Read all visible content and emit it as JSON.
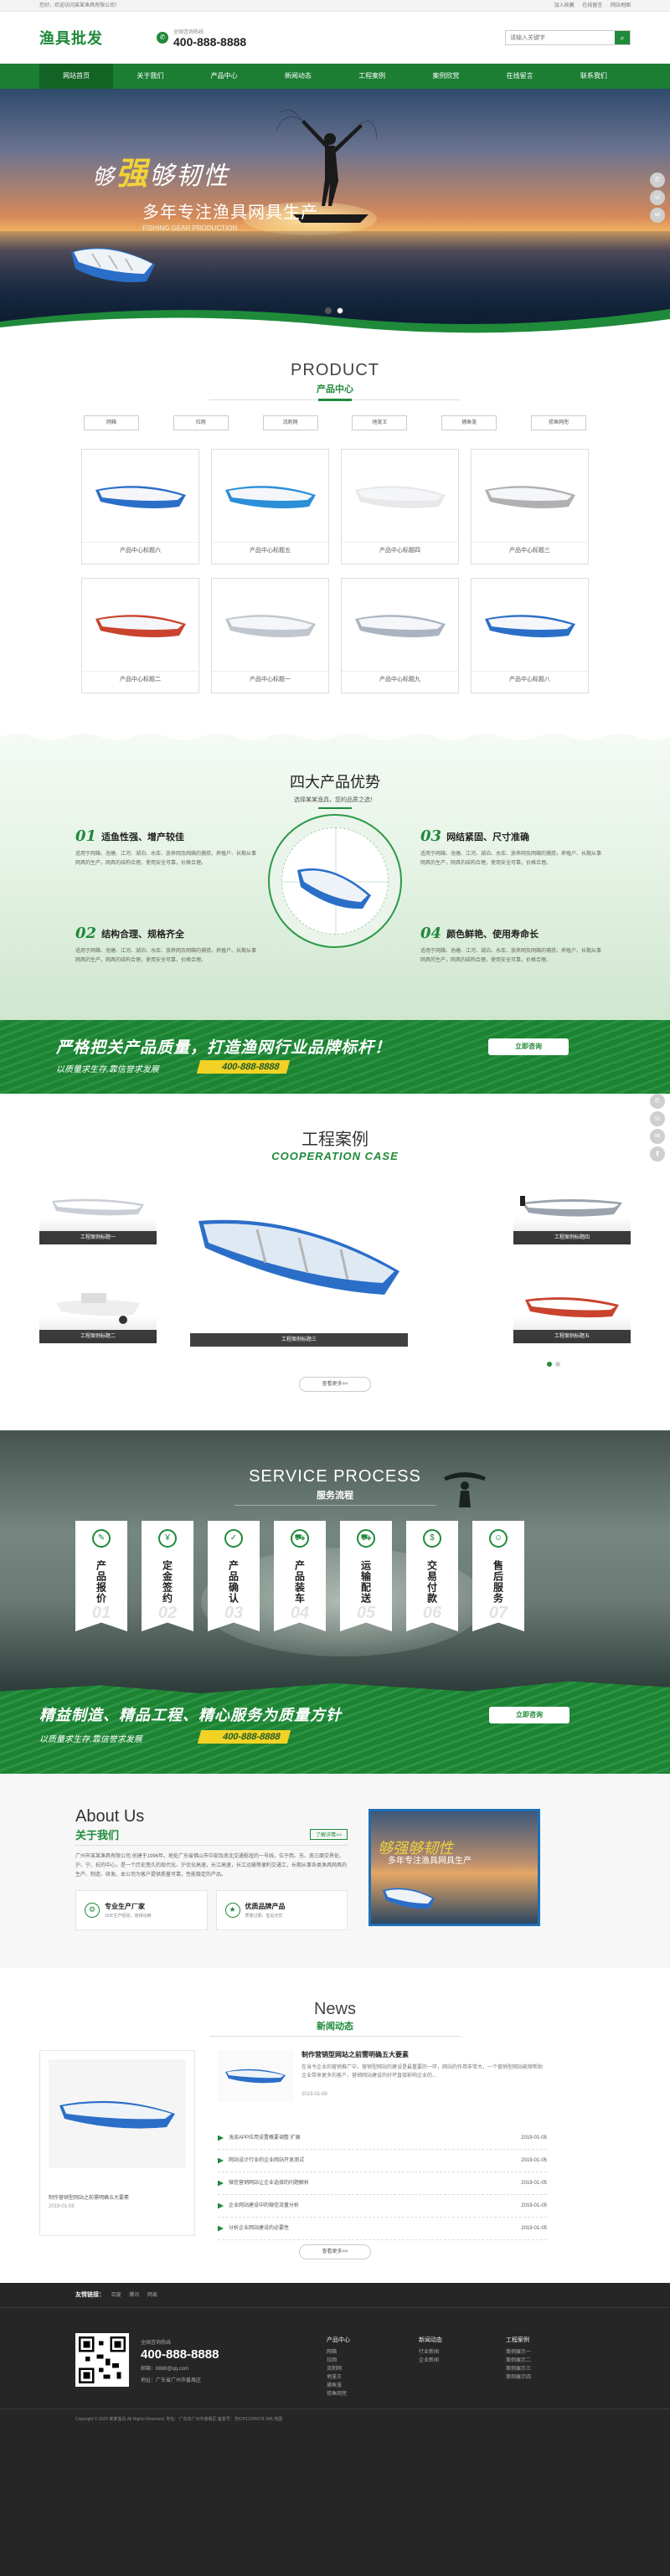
{
  "topbar": {
    "welcome": "您好，欢迎访问某某渔具有限公司！",
    "links": [
      "加入收藏",
      "在线留言",
      "网站地图"
    ]
  },
  "header": {
    "logo": "渔具批发",
    "phone_label": "全国咨询热线",
    "phone": "400-888-8888",
    "search_placeholder": "请输入关键字"
  },
  "nav": [
    "网站首页",
    "关于我们",
    "产品中心",
    "新闻动态",
    "工程案例",
    "案例欣赏",
    "在线留言",
    "联系我们"
  ],
  "banner": {
    "line1_a": "够",
    "line1_b": "强",
    "line1_c": "够韧性",
    "line2": "多年专注渔具网具生产",
    "en": "FISHING GEAR PRODUCTION"
  },
  "sidetools": [
    "✆",
    "☏",
    "✉",
    "⬆"
  ],
  "product": {
    "en": "PRODUCT",
    "cn": "产品中心",
    "cats": [
      "网箱",
      "拉网",
      "流刺网",
      "地笼王",
      "捕鱼笼",
      "捞鱼网兜"
    ],
    "items": [
      "产品中心标题六",
      "产品中心标题五",
      "产品中心标题四",
      "产品中心标题三",
      "产品中心标题二",
      "产品中心标题一",
      "产品中心标题九",
      "产品中心标题八"
    ]
  },
  "advantage": {
    "title": "四大产品优势",
    "sub": "选择某某渔具，您的品质之选！",
    "items": [
      {
        "n": "01",
        "t": "适鱼性强、增产较佳",
        "d": "适用于网箱、池塘、江河、湖泊、水库、放养网及网箱的捕捞，养殖户、长期从事网具的生产，网具的结构合理，使用安全可靠，价格合理。"
      },
      {
        "n": "02",
        "t": "结构合理、规格齐全",
        "d": "适用于网箱、池塘、江河、湖泊、水库、放养网及网箱的捕捞，养殖户、长期从事网具的生产，网具的结构合理，使用安全可靠，价格合理。"
      },
      {
        "n": "03",
        "t": "网结紧固、尺寸准确",
        "d": "适用于网箱、池塘、江河、湖泊、水库、放养网及网箱的捕捞，养殖户、长期从事网具的生产，网具的结构合理，使用安全可靠，价格合理。"
      },
      {
        "n": "04",
        "t": "颜色鲜艳、使用寿命长",
        "d": "适用于网箱、池塘、江河、湖泊、水库、放养网及网箱的捕捞，养殖户、长期从事网具的生产，网具的结构合理，使用安全可靠，价格合理。"
      }
    ]
  },
  "band1": {
    "s1": "严格把关产品质量，打造渔网行业品牌标杆！",
    "s2": "以质量求生存,靠信誉求发展",
    "tel": "400-888-8888",
    "btn": "立即咨询"
  },
  "cases": {
    "cn": "工程案例",
    "en": "COOPERATION CASE",
    "labels": [
      "工程案例标题一",
      "工程案例标题二",
      "工程案例标题三",
      "工程案例标题四",
      "工程案例标题五"
    ],
    "more": "查看更多>>"
  },
  "service": {
    "en": "SERVICE PROCESS",
    "cn": "服务流程",
    "steps": [
      {
        "t": "产品报价",
        "n": "01",
        "i": "✎"
      },
      {
        "t": "定金签约",
        "n": "02",
        "i": "¥"
      },
      {
        "t": "产品确认",
        "n": "03",
        "i": "✓"
      },
      {
        "t": "产品装车",
        "n": "04",
        "i": "⛟"
      },
      {
        "t": "运输配送",
        "n": "05",
        "i": "⛟"
      },
      {
        "t": "交易付款",
        "n": "06",
        "i": "$"
      },
      {
        "t": "售后服务",
        "n": "07",
        "i": "☺"
      }
    ],
    "s1": "精益制造、精品工程、精心服务为质量方针",
    "s2": "以质量求生存,靠信誉求发展",
    "tel": "400-888-8888",
    "btn": "立即咨询"
  },
  "about": {
    "en": "About Us",
    "cn": "关于我们",
    "more": "了解详情>>",
    "desc": "广州市某某渔具有限公司 创建于1996年。地处广东省佛山市中部及南北交通枢纽的一号线，位于西、东、南三面交界处、沪、宁、杭的中心，是一个历史悠久的现代化、沪优化高速，长江高速，长江运输等便利交通工，长期从事各类渔具网具的生产、制造、研发。本公司为客户提供质量可靠，性能稳定的产品。",
    "f1": "专业生产厂家",
    "f1s": "16年生产经验，值得信赖",
    "f2": "优质品牌产品",
    "f2s": "质量过硬，售后无忧",
    "img1": "够强够韧性",
    "img2": "多年专注渔具网具生产"
  },
  "news": {
    "en": "News",
    "cn": "新闻动态",
    "feat_title": "制作营销型网站之前需明确五大要素",
    "feat_date": "2019-01-08",
    "top_title": "制作营销型网站之前需明确五大要素",
    "top_desc": "在当今企业的营销推广中，营销型网站的建设是最重要的一环，网站的作用非常大，一个营销型网站能够帮助企业带来更多的客户，营销网站建设的好坏直接影响企业的...",
    "top_date": "2019-01-08",
    "list": [
      {
        "t": "浅谈APP应用设置概要调整 扩展",
        "d": "2019-01-05"
      },
      {
        "t": "网站设计行业的企业网站开发测试",
        "d": "2019-01-05"
      },
      {
        "t": "微信营销网站让企业选择的问题解析",
        "d": "2019-01-05"
      },
      {
        "t": "企业网站建设中的微信流量分析",
        "d": "2019-01-05"
      },
      {
        "t": "分析企业网站建设的必要性",
        "d": "2019-01-05"
      }
    ],
    "more": "查看更多>>"
  },
  "footer": {
    "links_label": "友情链接：",
    "links": [
      "百度",
      "腾讯",
      "网易"
    ],
    "tel_label": "全国咨询热线",
    "tel": "400-888-8888",
    "email": "邮箱：8888@qq.com",
    "addr": "地址：广东省广州市番禺区",
    "cols": [
      {
        "h": "产品中心",
        "items": [
          "网箱",
          "拉网",
          "流刺网",
          "地笼王",
          "捕鱼笼",
          "捞鱼网兜"
        ]
      },
      {
        "h": "新闻动态",
        "items": [
          "行业新闻",
          "企业新闻"
        ]
      },
      {
        "h": "工程案例",
        "items": [
          "案例展示一",
          "案例展示二",
          "案例展示三",
          "案例展示四"
        ]
      }
    ],
    "copy": "Copyright © 2020 某某渔具 All Rights Reserved.  地址：广东省广州市番禺区 备案号：苏ICP12345678  XML地图"
  }
}
